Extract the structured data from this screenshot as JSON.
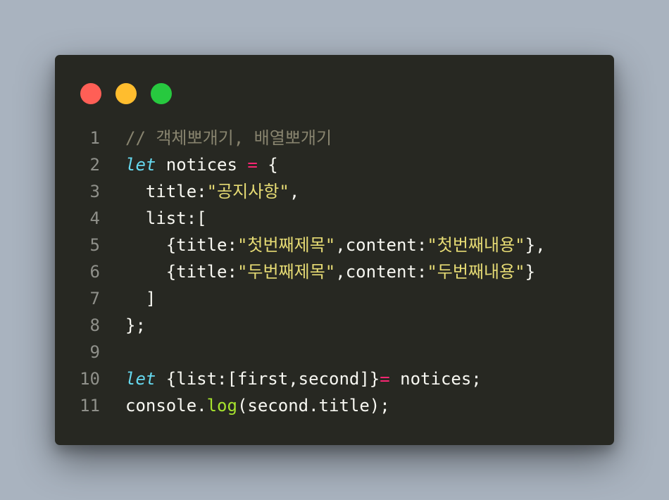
{
  "window": {
    "controls": {
      "close_color": "#ff5f56",
      "minimize_color": "#ffbd2e",
      "maximize_color": "#27c93f"
    }
  },
  "code": {
    "lines": [
      {
        "number": "1",
        "tokens": [
          {
            "t": "c",
            "v": "// 객체뽀개기, 배열뽀개기"
          }
        ]
      },
      {
        "number": "2",
        "tokens": [
          {
            "t": "k",
            "v": "let"
          },
          {
            "t": "p",
            "v": " notices "
          },
          {
            "t": "op",
            "v": "="
          },
          {
            "t": "p",
            "v": " {"
          }
        ]
      },
      {
        "number": "3",
        "tokens": [
          {
            "t": "p",
            "v": "  title:"
          },
          {
            "t": "s",
            "v": "\"공지사항\""
          },
          {
            "t": "p",
            "v": ","
          }
        ]
      },
      {
        "number": "4",
        "tokens": [
          {
            "t": "p",
            "v": "  list:["
          }
        ]
      },
      {
        "number": "5",
        "tokens": [
          {
            "t": "p",
            "v": "    {title:"
          },
          {
            "t": "s",
            "v": "\"첫번째제목\""
          },
          {
            "t": "p",
            "v": ",content:"
          },
          {
            "t": "s",
            "v": "\"첫번째내용\""
          },
          {
            "t": "p",
            "v": "},"
          }
        ]
      },
      {
        "number": "6",
        "tokens": [
          {
            "t": "p",
            "v": "    {title:"
          },
          {
            "t": "s",
            "v": "\"두번째제목\""
          },
          {
            "t": "p",
            "v": ",content:"
          },
          {
            "t": "s",
            "v": "\"두번째내용\""
          },
          {
            "t": "p",
            "v": "}"
          }
        ]
      },
      {
        "number": "7",
        "tokens": [
          {
            "t": "p",
            "v": "  ]"
          }
        ]
      },
      {
        "number": "8",
        "tokens": [
          {
            "t": "p",
            "v": "};"
          }
        ]
      },
      {
        "number": "9",
        "tokens": []
      },
      {
        "number": "10",
        "tokens": [
          {
            "t": "k",
            "v": "let"
          },
          {
            "t": "p",
            "v": " {list:[first,second]}"
          },
          {
            "t": "op",
            "v": "="
          },
          {
            "t": "p",
            "v": " notices;"
          }
        ]
      },
      {
        "number": "11",
        "tokens": [
          {
            "t": "p",
            "v": "console."
          },
          {
            "t": "fn",
            "v": "log"
          },
          {
            "t": "p",
            "v": "(second.title);"
          }
        ]
      }
    ]
  }
}
